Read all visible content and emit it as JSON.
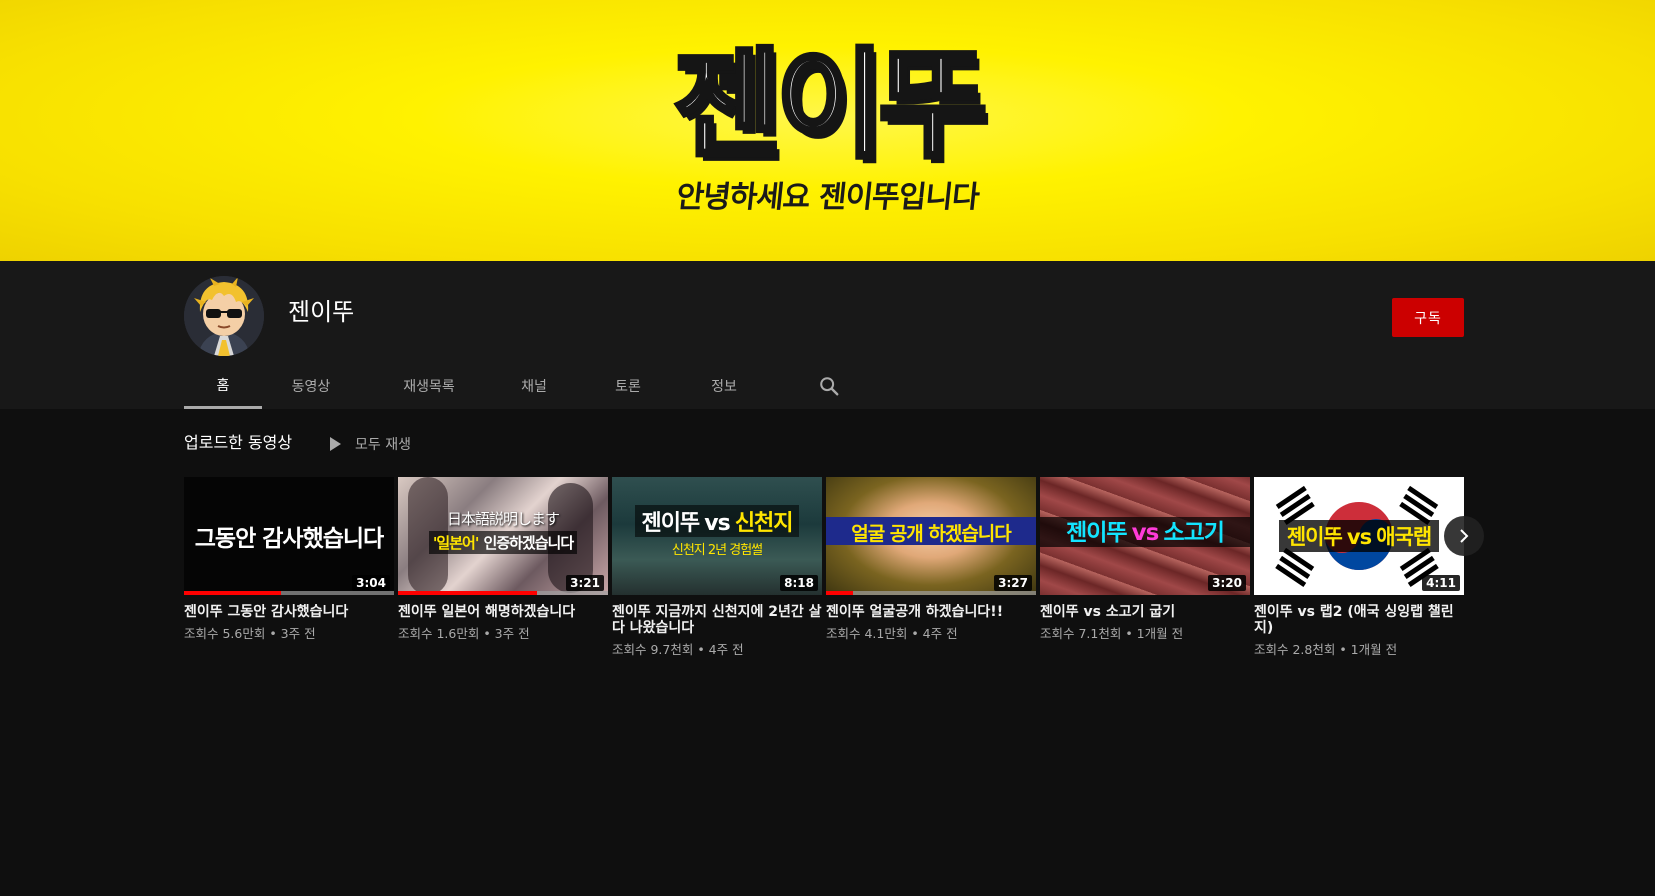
{
  "banner": {
    "logo_text": "젠이뚜",
    "tagline": "안녕하세요 젠이뚜입니다"
  },
  "channel": {
    "name": "젠이뚜",
    "subscribe_label": "구독"
  },
  "tabs": [
    {
      "label": "홈",
      "active": true
    },
    {
      "label": "동영상",
      "active": false
    },
    {
      "label": "재생목록",
      "active": false
    },
    {
      "label": "채널",
      "active": false
    },
    {
      "label": "토론",
      "active": false
    },
    {
      "label": "정보",
      "active": false
    }
  ],
  "search_icon": "search-icon",
  "shelf": {
    "title": "업로드한 동영상",
    "play_all_label": "모두 재생",
    "videos": [
      {
        "thumb_text": "그동안 감사했습니다",
        "duration": "3:04",
        "progress": 0.46,
        "title": "젠이뚜 그동안 감사했습니다",
        "meta": "조회수 5.6만회 • 3주 전",
        "accent": "#000000"
      },
      {
        "thumb_text_top": "日本語説明します",
        "thumb_text_bottom_a": "'일본어'",
        "thumb_text_bottom_b": "인증하겠습니다",
        "duration": "3:21",
        "progress": 0.66,
        "title": "젠이뚜 일본어 해명하겠습니다",
        "meta": "조회수 1.6만회 • 3주 전"
      },
      {
        "thumb_text_a": "젠이뚜",
        "thumb_text_vs": "vs",
        "thumb_text_b": "신천지",
        "thumb_text_sub": "신천지 2년 경험썰",
        "duration": "8:18",
        "title": "젠이뚜 지금까지 신천지에 2년간 살다 나왔습니다",
        "meta": "조회수 9.7천회 • 4주 전"
      },
      {
        "thumb_text": "얼굴 공개 하겠습니다",
        "duration": "3:27",
        "progress": 0.13,
        "title": "젠이뚜 얼굴공개 하겠습니다!!",
        "meta": "조회수 4.1만회 • 4주 전"
      },
      {
        "thumb_text_a": "젠이뚜",
        "thumb_text_vs": "vs",
        "thumb_text_b": "소고기",
        "duration": "3:20",
        "title": "젠이뚜 vs 소고기 굽기",
        "meta": "조회수 7.1천회 • 1개월 전"
      },
      {
        "thumb_text_a": "젠이뚜",
        "thumb_text_vs": "vs",
        "thumb_text_b": "애국랩",
        "duration": "4:11",
        "title": "젠이뚜 vs 랩2 (애국 싱잉랩 챌린지)",
        "meta": "조회수 2.8천회 • 1개월 전"
      }
    ]
  },
  "next_icon": "chevron-right-icon"
}
